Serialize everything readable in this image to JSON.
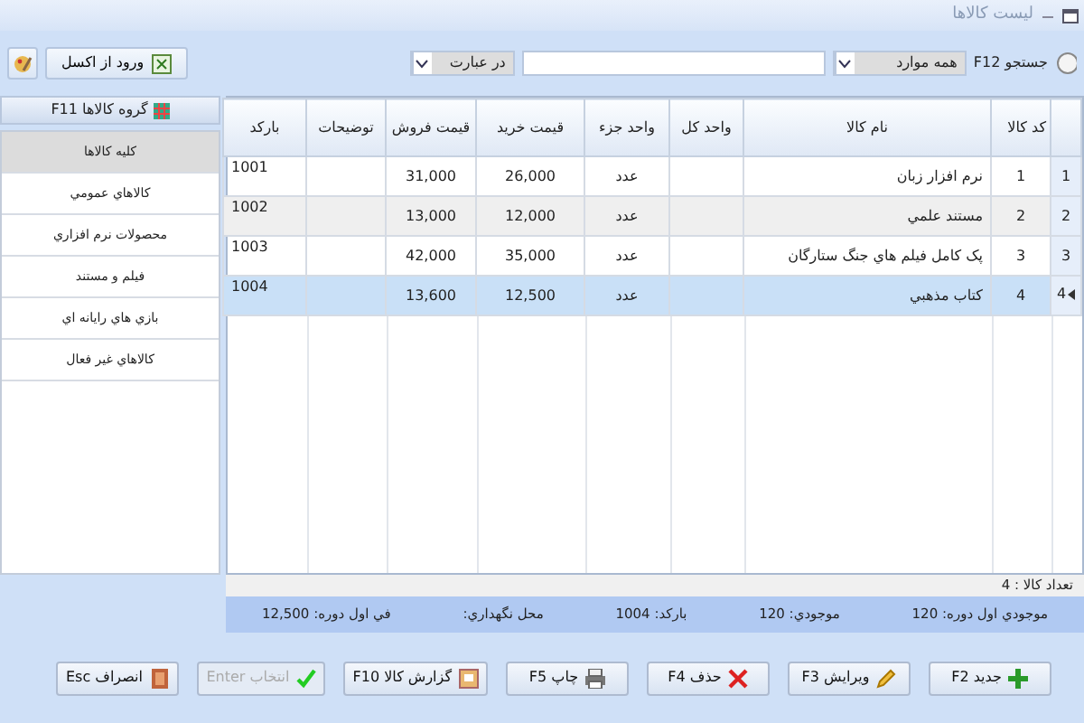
{
  "window": {
    "title": "ليست کالاها"
  },
  "toolbar": {
    "search_label": "جستجو F12",
    "scope": "همه موارد",
    "match": "در عبارت",
    "excel_button": "ورود از اکسل"
  },
  "table": {
    "columns": [
      "کد کالا",
      "نام کالا",
      "واحد کل",
      "واحد جزء",
      "قيمت خريد",
      "قيمت فروش",
      "توضيحات",
      "بارکد"
    ],
    "rows": [
      {
        "index": "1",
        "selected": false,
        "cells": [
          "1",
          "نرم افزار زبان",
          "",
          "عدد",
          "26,000",
          "31,000",
          "",
          "1001"
        ]
      },
      {
        "index": "2",
        "selected": false,
        "cells": [
          "2",
          "مستند علمي",
          "",
          "عدد",
          "12,000",
          "13,000",
          "",
          "1002"
        ]
      },
      {
        "index": "3",
        "selected": false,
        "cells": [
          "3",
          "پک کامل فيلم هاي جنگ ستارگان",
          "",
          "عدد",
          "35,000",
          "42,000",
          "",
          "1003"
        ]
      },
      {
        "index": "4",
        "selected": true,
        "cells": [
          "4",
          "کتاب مذهبي",
          "",
          "عدد",
          "12,500",
          "13,600",
          "",
          "1004"
        ]
      }
    ]
  },
  "sidebar": {
    "header": "گروه کالاها F11",
    "items": [
      {
        "label": "کليه کالاها",
        "selected": true
      },
      {
        "label": "کالاهاي عمومي",
        "selected": false
      },
      {
        "label": "محصولات نرم افزاري",
        "selected": false
      },
      {
        "label": "فيلم و مستند",
        "selected": false
      },
      {
        "label": "بازي هاي رايانه اي",
        "selected": false
      },
      {
        "label": "کالاهاي غير فعال",
        "selected": false
      }
    ]
  },
  "count": "تعداد کالا : 4",
  "details": [
    "موجودي اول دوره: 120",
    "موجودي: 120",
    "بارکد: 1004",
    "محل نگهداري:",
    "في اول دوره: 12,500"
  ],
  "buttons": [
    {
      "label": "جديد F2",
      "kind": "plus",
      "disabled": false
    },
    {
      "label": "ويرايش F3",
      "kind": "pencil",
      "disabled": false
    },
    {
      "label": "حذف F4",
      "kind": "cross",
      "disabled": false
    },
    {
      "label": "چاپ F5",
      "kind": "printer",
      "disabled": false
    },
    {
      "label": "گزارش کالا F10",
      "kind": "report",
      "disabled": false
    },
    {
      "label": "انتخاب Enter",
      "kind": "check",
      "disabled": true
    },
    {
      "label": "انصراف Esc",
      "kind": "door",
      "disabled": false
    }
  ]
}
